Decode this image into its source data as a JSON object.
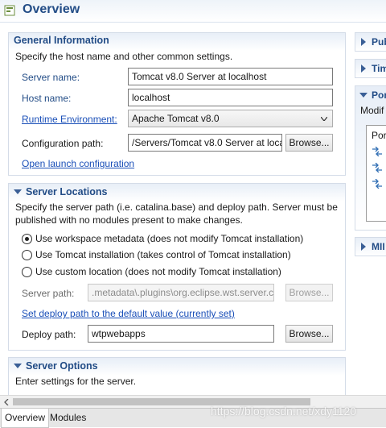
{
  "header": {
    "title": "Overview"
  },
  "general": {
    "title": "General Information",
    "description": "Specify the host name and other common settings.",
    "server_name_label": "Server name:",
    "server_name_value": "Tomcat v8.0 Server at localhost",
    "host_name_label": "Host name:",
    "host_name_value": "localhost",
    "runtime_label": "Runtime Environment:",
    "runtime_value": "Apache Tomcat v8.0",
    "config_label": "Configuration path:",
    "config_value": "/Servers/Tomcat v8.0 Server at loca",
    "browse_label": "Browse...",
    "open_launch_link": "Open launch configuration"
  },
  "locations": {
    "title": "Server Locations",
    "description_line1": "Specify the server path (i.e. catalina.base) and deploy path. Server must be",
    "description_line2": "published with no modules present to make changes.",
    "radio_workspace": "Use workspace metadata (does not modify Tomcat installation)",
    "radio_tomcat": "Use Tomcat installation (takes control of Tomcat installation)",
    "radio_custom": "Use custom location (does not modify Tomcat installation)",
    "selected": "workspace",
    "server_path_label": "Server path:",
    "server_path_value": ".metadata\\.plugins\\org.eclipse.wst.server.c",
    "server_path_browse": "Browse...",
    "set_deploy_link": "Set deploy path to the default value (currently set)",
    "deploy_path_label": "Deploy path:",
    "deploy_path_value": "wtpwebapps",
    "deploy_browse": "Browse..."
  },
  "options": {
    "title": "Server Options",
    "description": "Enter settings for the server."
  },
  "right_panel": {
    "publishing": "Pub",
    "timeouts": "Tim",
    "ports": "Por",
    "ports_desc": "Modif",
    "ports_inner": "Por",
    "mime": "MII"
  },
  "tabs": [
    {
      "label": "Overview"
    },
    {
      "label": "Modules"
    }
  ],
  "watermark": "https://blog.csdn.net/xdy1120",
  "colors": {
    "section_title": "#224c86",
    "link": "#1a4fb8"
  }
}
